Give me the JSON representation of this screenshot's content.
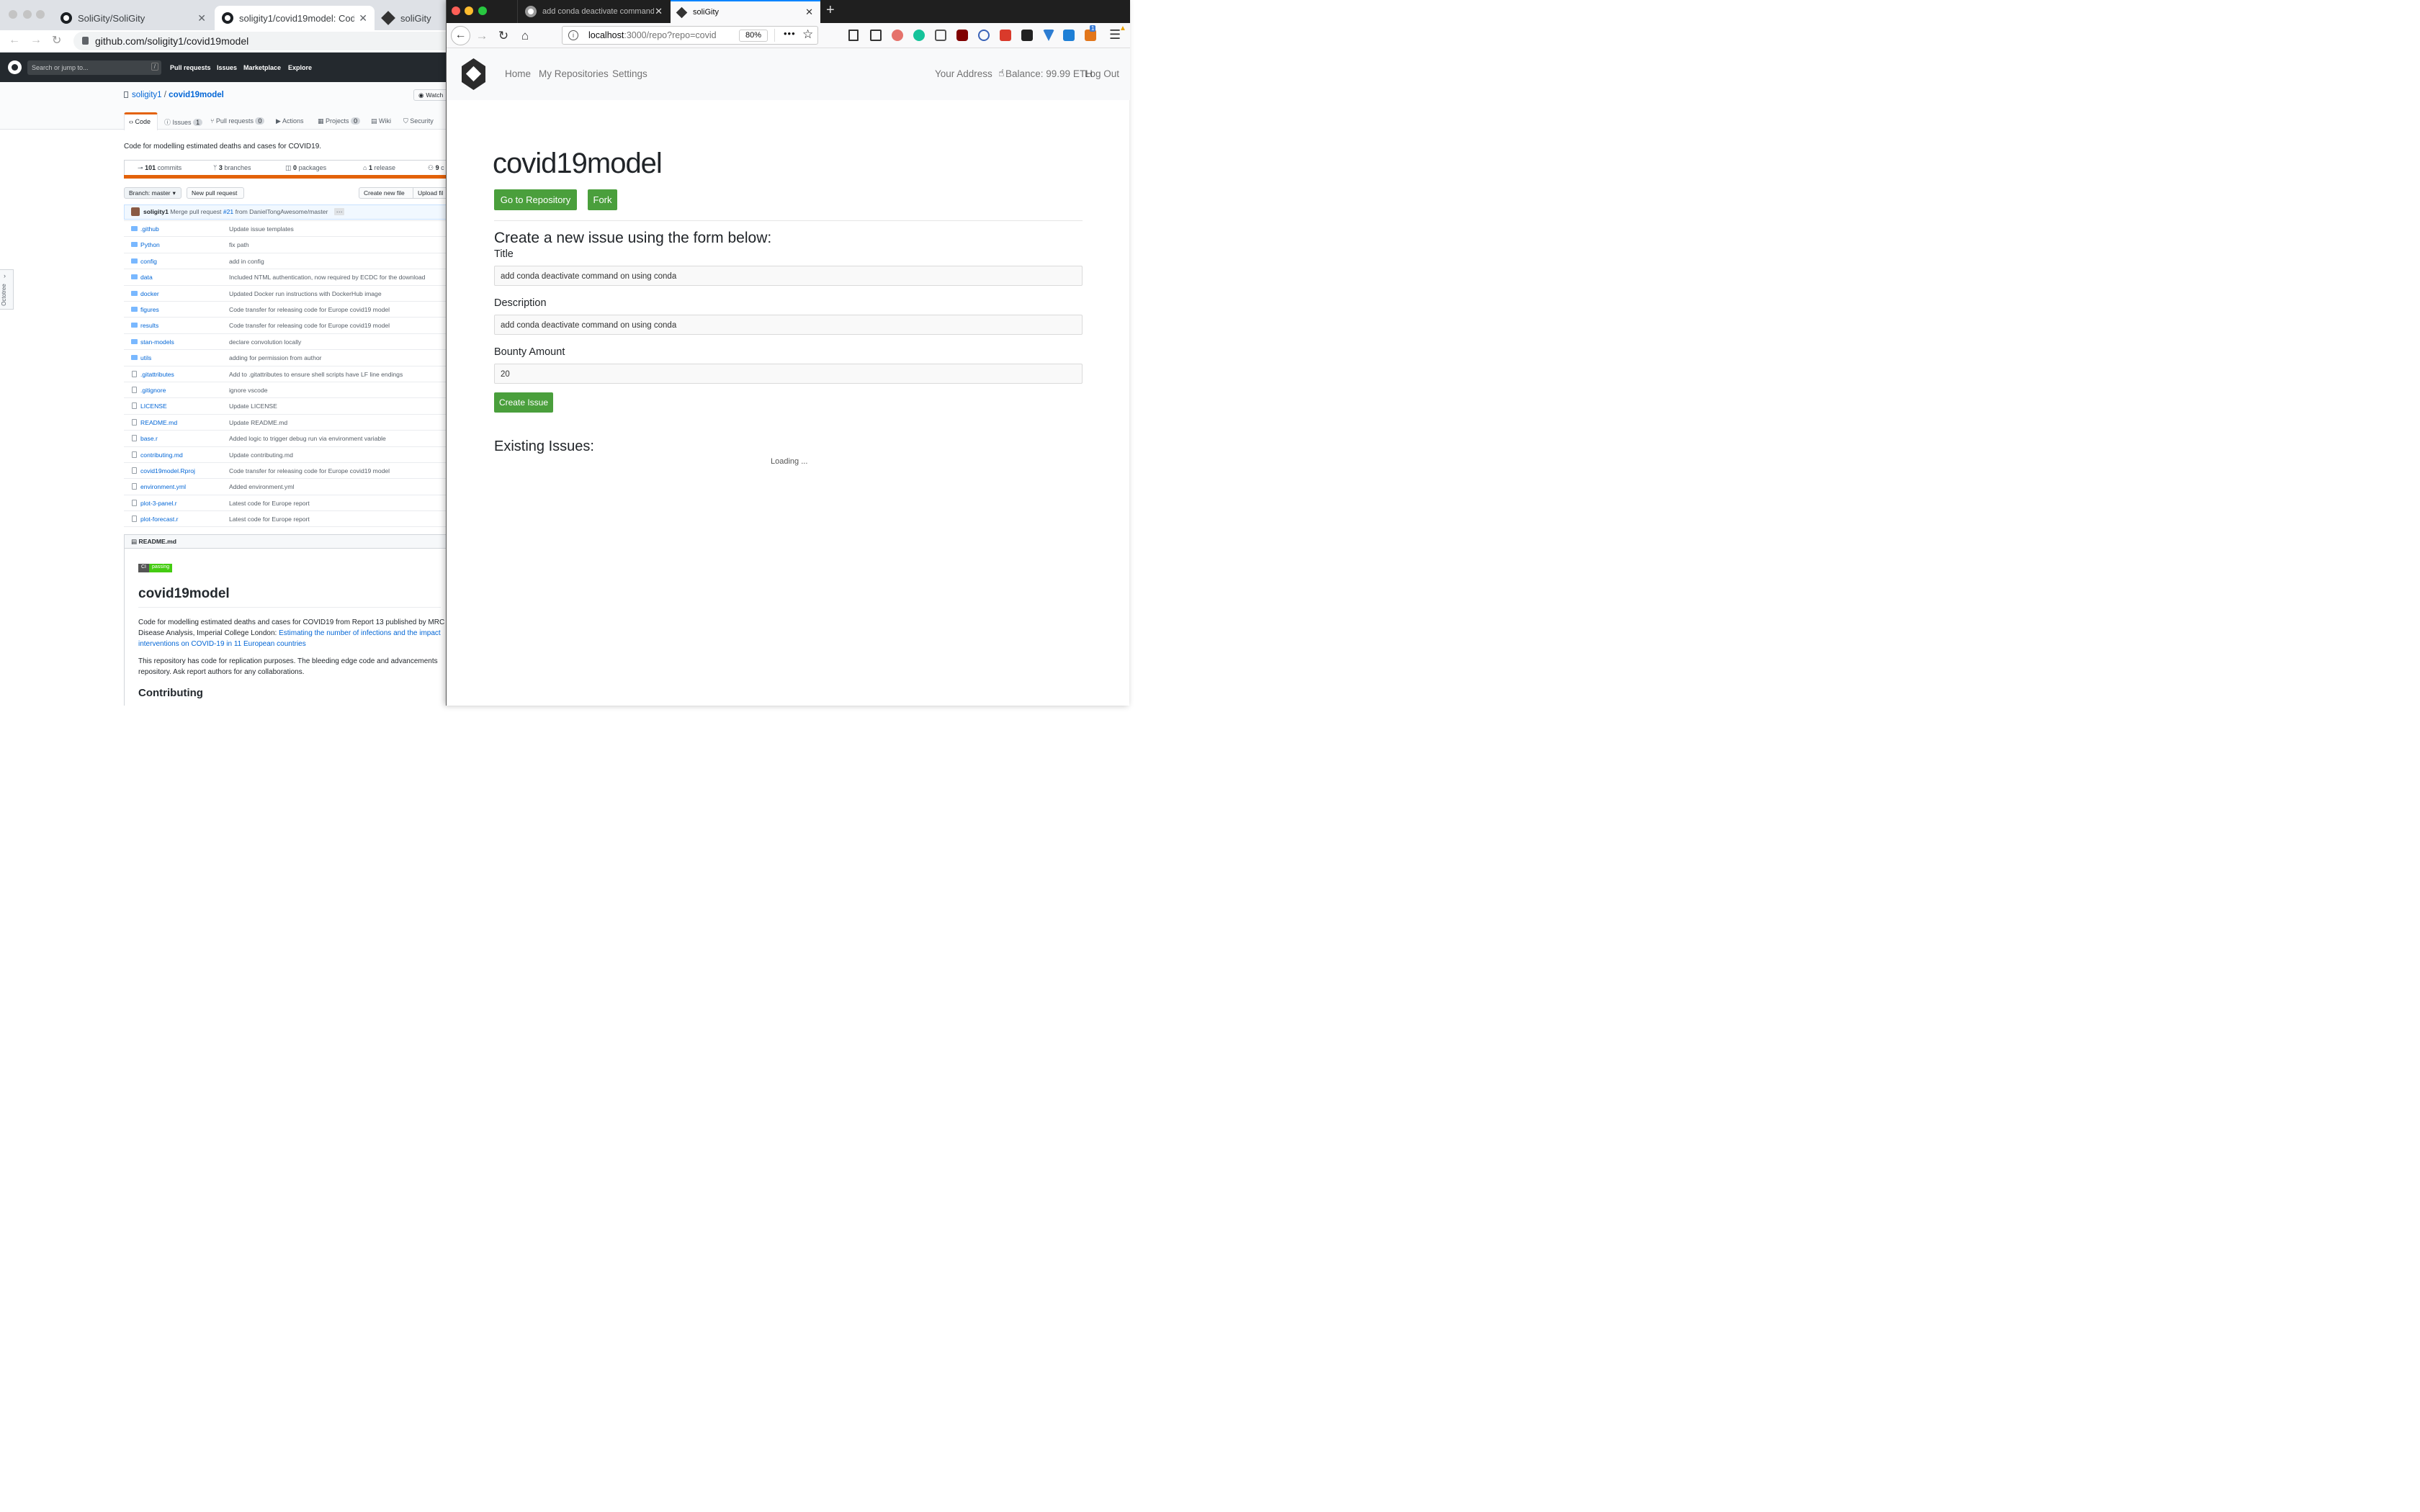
{
  "chrome": {
    "tabs": [
      "SoliGity/SoliGity",
      "soligity1/covid19model: Code for",
      "soliGity"
    ],
    "url": "github.com/soligity1/covid19model"
  },
  "github": {
    "search_placeholder": "Search or jump to...",
    "search_key": "/",
    "nav": [
      "Pull requests",
      "Issues",
      "Marketplace",
      "Explore"
    ],
    "owner": "soligity1",
    "sep": "/",
    "repo": "covid19model",
    "watch": "Watch",
    "tabs": [
      {
        "label": "Code"
      },
      {
        "label": "Issues",
        "count": "1"
      },
      {
        "label": "Pull requests",
        "count": "0"
      },
      {
        "label": "Actions"
      },
      {
        "label": "Projects",
        "count": "0"
      },
      {
        "label": "Wiki"
      },
      {
        "label": "Security"
      }
    ],
    "description": "Code for modelling estimated deaths and cases for COVID19.",
    "stats": [
      {
        "num": "101",
        "label": "commits"
      },
      {
        "num": "3",
        "label": "branches"
      },
      {
        "num": "0",
        "label": "packages"
      },
      {
        "num": "1",
        "label": "release"
      },
      {
        "num": "9",
        "label": "c"
      }
    ],
    "branch_label": "Branch: master",
    "new_pr": "New pull request",
    "create_file": "Create new file",
    "upload": "Upload fil",
    "commit": {
      "author": "soligity1",
      "text": "Merge pull request",
      "pr": "#21",
      "from": "from DanielTongAwesome/master"
    },
    "files": [
      {
        "name": ".github",
        "msg": "Update issue templates",
        "type": "dir"
      },
      {
        "name": "Python",
        "msg": "fix path",
        "type": "dir"
      },
      {
        "name": "config",
        "msg": "add in config",
        "type": "dir"
      },
      {
        "name": "data",
        "msg": "Included NTML authentication, now required by ECDC for the download",
        "type": "dir"
      },
      {
        "name": "docker",
        "msg": "Updated Docker run instructions with DockerHub image",
        "type": "dir"
      },
      {
        "name": "figures",
        "msg": "Code transfer for releasing code for Europe covid19 model",
        "type": "dir"
      },
      {
        "name": "results",
        "msg": "Code transfer for releasing code for Europe covid19 model",
        "type": "dir"
      },
      {
        "name": "stan-models",
        "msg": "declare convolution locally",
        "type": "dir"
      },
      {
        "name": "utils",
        "msg": "adding for permission from author",
        "type": "dir"
      },
      {
        "name": ".gitattributes",
        "msg": "Add to .gitattributes to ensure shell scripts have LF line endings",
        "type": "file"
      },
      {
        "name": ".gitignore",
        "msg": "ignore vscode",
        "type": "file"
      },
      {
        "name": "LICENSE",
        "msg": "Update LICENSE",
        "type": "file"
      },
      {
        "name": "README.md",
        "msg": "Update README.md",
        "type": "file"
      },
      {
        "name": "base.r",
        "msg": "Added logic to trigger debug run via environment variable",
        "type": "file"
      },
      {
        "name": "contributing.md",
        "msg": "Update contributing.md",
        "type": "file"
      },
      {
        "name": "covid19model.Rproj",
        "msg": "Code transfer for releasing code for Europe covid19 model",
        "type": "file"
      },
      {
        "name": "environment.yml",
        "msg": "Added environment.yml",
        "type": "file"
      },
      {
        "name": "plot-3-panel.r",
        "msg": "Latest code for Europe report",
        "type": "file"
      },
      {
        "name": "plot-forecast.r",
        "msg": "Latest code for Europe report",
        "type": "file"
      }
    ],
    "readme": {
      "header": "README.md",
      "badge_left": "CI",
      "badge_right": "passing",
      "title": "covid19model",
      "p1a": "Code for modelling estimated deaths and cases for COVID19 from Report 13 published by MRC",
      "p1b": "Disease Analysis, Imperial College London: ",
      "p1link1": "Estimating the number of infections and the impact",
      "p1link2": "interventions on COVID-19 in 11 European countries",
      "p2a": "This repository has code for replication purposes. The bleeding edge code and advancements",
      "p2b": "repository. Ask report authors for any collaborations.",
      "h2": "Contributing"
    },
    "octotree": "Octotree"
  },
  "firefox": {
    "tabs": [
      "add conda deactivate command o",
      "soliGity"
    ],
    "url_host": "localhost",
    "url_rest": ":3000/repo?repo=covid",
    "zoom": "80%",
    "badge": "1"
  },
  "app": {
    "nav": [
      "Home",
      "My Repositories",
      "Settings"
    ],
    "address": "Your Address",
    "balance": "Balance: 99.99 ETH",
    "logout": "Log Out",
    "repo_title": "covid19model",
    "go_btn": "Go to Repository",
    "fork_btn": "Fork",
    "form_heading": "Create a new issue using the form below:",
    "title_label": "Title",
    "title_value": "add conda deactivate command on using conda",
    "desc_label": "Description",
    "desc_value": "add conda deactivate command on using conda",
    "bounty_label": "Bounty Amount",
    "bounty_value": "20",
    "create_btn": "Create Issue",
    "existing_heading": "Existing Issues:",
    "loading": "Loading ..."
  }
}
